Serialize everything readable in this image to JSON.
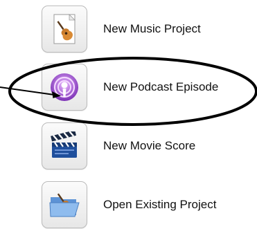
{
  "items": [
    {
      "label": "New Music Project",
      "icon": "guitar-document-icon"
    },
    {
      "label": "New Podcast Episode",
      "icon": "podcast-icon"
    },
    {
      "label": "New Movie Score",
      "icon": "clapperboard-icon"
    },
    {
      "label": "Open Existing Project",
      "icon": "open-folder-guitar-icon"
    }
  ],
  "annotation": {
    "color": "#000000",
    "shapes": [
      "highlight-ellipse",
      "pointer-arrow"
    ]
  },
  "colors": {
    "podcast_purple": "#7b2fb5",
    "tile_border": "#b9b9b9"
  }
}
